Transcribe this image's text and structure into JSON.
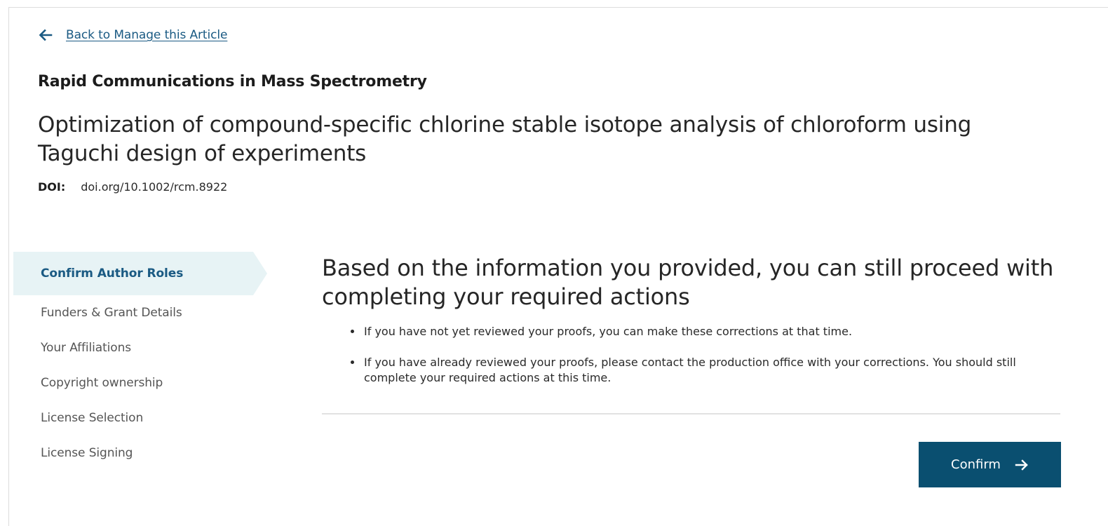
{
  "header": {
    "back_link": {
      "label": "Back to Manage this Article",
      "icon": "arrow-left-icon"
    },
    "journal_name": "Rapid Communications in Mass Spectrometry",
    "article_title": "Optimization of compound-specific chlorine stable isotope analysis of chloroform using Taguchi design of experiments",
    "doi": {
      "label": "DOI:",
      "value": "doi.org/10.1002/rcm.8922"
    }
  },
  "sidebar": {
    "steps": [
      {
        "label": "Confirm Author Roles",
        "active": true
      },
      {
        "label": "Funders & Grant Details",
        "active": false
      },
      {
        "label": "Your Affiliations",
        "active": false
      },
      {
        "label": "Copyright ownership",
        "active": false
      },
      {
        "label": "License Selection",
        "active": false
      },
      {
        "label": "License Signing",
        "active": false
      }
    ]
  },
  "main": {
    "heading": "Based on the information you provided, you can still proceed with completing your required actions",
    "bullets": [
      "If you have not yet reviewed your proofs, you can make these corrections at that time.",
      "If you have already reviewed your proofs, please contact the production office with your corrections. You should still complete your required actions at this time."
    ],
    "confirm_button": {
      "label": "Confirm",
      "icon": "arrow-right-icon"
    }
  },
  "colors": {
    "link": "#1a5a83",
    "active_step_bg": "#e7f3f5",
    "primary_button": "#0a4f70",
    "divider": "#e2e2e2"
  }
}
